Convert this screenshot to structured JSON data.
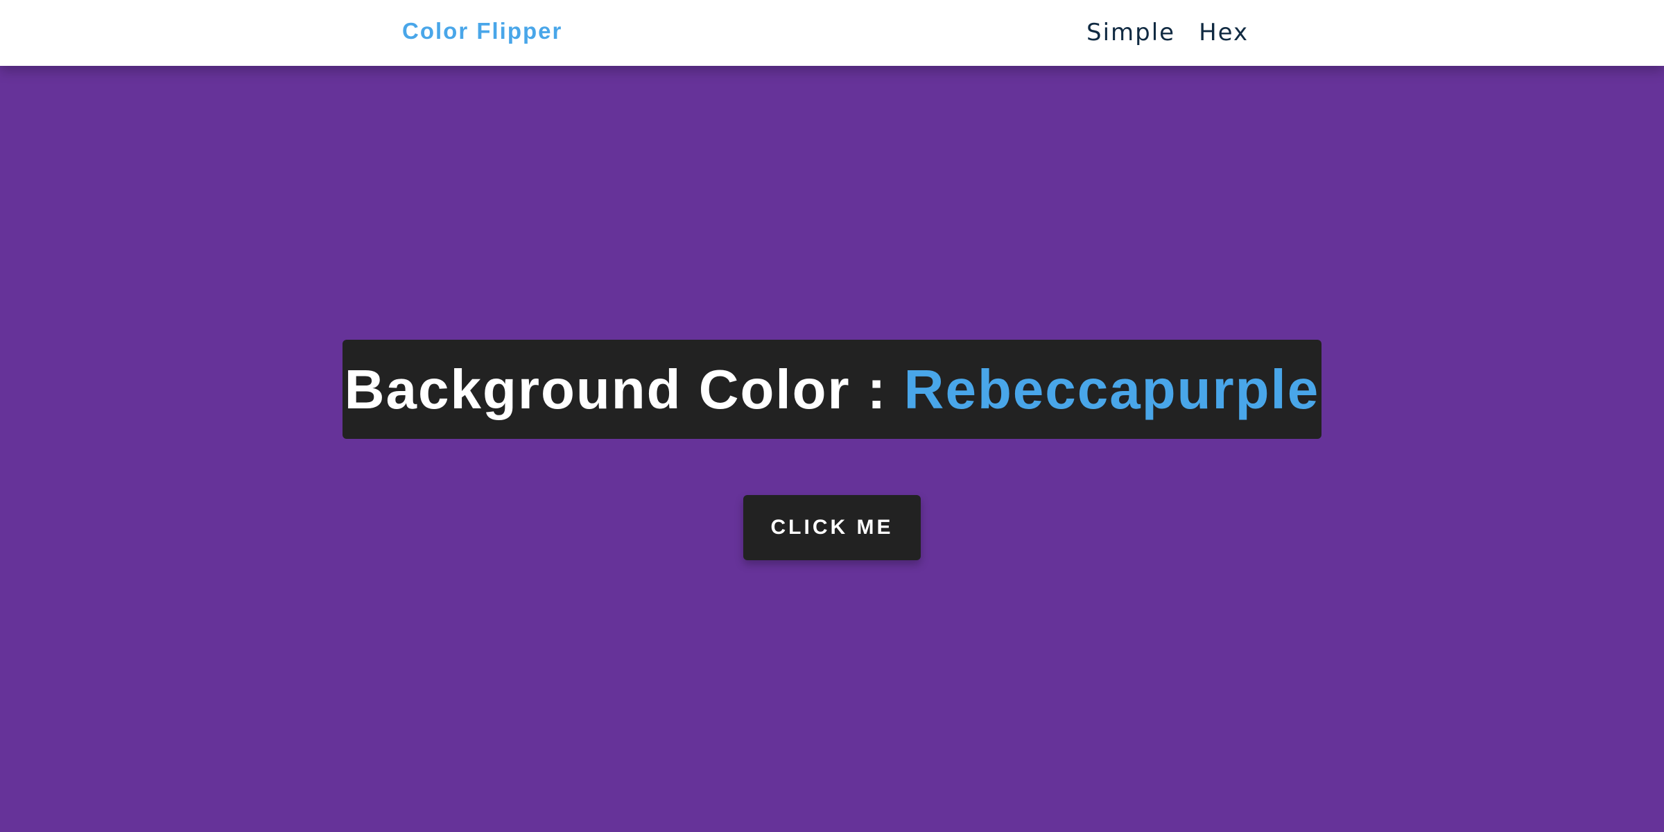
{
  "navbar": {
    "brand": "Color Flipper",
    "links": [
      {
        "label": "Simple"
      },
      {
        "label": "Hex"
      }
    ]
  },
  "main": {
    "heading_prefix": "Background Color : ",
    "color_name": "Rebeccapurple",
    "button_label": "CLICK ME"
  },
  "colors": {
    "background": "#663399",
    "accent": "#49a6e9",
    "panel": "#222222",
    "nav_text": "#102a42",
    "navbar_bg": "#ffffff"
  }
}
